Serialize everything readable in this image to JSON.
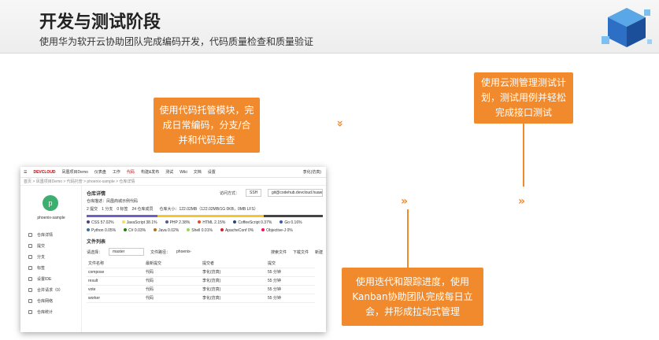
{
  "slide": {
    "title": "开发与测试阶段",
    "subtitle": "使用华为软开云协助团队完成编码开发，代码质量检查和质量验证"
  },
  "callouts": {
    "code": "使用代码托管模块，完成日常编码，分支/合并和代码走查",
    "test": "使用云测管理测试计划，测试用例并轻松完成接口测试",
    "kanban": "使用迭代和跟踪进度，使用Kanban协助团队完成每日立会，并形成拉动式管理"
  },
  "arrows": {
    "down": "»",
    "right": "»"
  },
  "colors": {
    "accent": "#f18a2c"
  },
  "shot": {
    "nav": {
      "logo": "DEVCLOUD",
      "project": "凤凰项目Demo",
      "items": [
        "仪表盘",
        "工作",
        "代码",
        "构建&发布",
        "测试",
        "Wiki",
        "文档",
        "设置"
      ],
      "active": "代码",
      "user": "李化(仿真)"
    },
    "crumb": {
      "path": "首页 > 凤凰项目Demo > 代码托管 > phoenix-sample > 仓库详情",
      "tabs": [
        "代码托管",
        "代码检查"
      ]
    },
    "repo": {
      "avatar": "p",
      "name": "phoenix-sample"
    },
    "menu": [
      "仓库详情",
      "提交",
      "分支",
      "标签",
      "设置IDE",
      "合并请求（0）",
      "仓库网络",
      "仓库统计"
    ],
    "detail": {
      "heading": "仓库详情",
      "desc": "仓库描述：凤凰商城示例代码",
      "clone_label": "访问方式：",
      "clone_proto": "SSH",
      "clone_url": "git@codehub.devcloud.huaw",
      "stats": "2 提交　1 分支　0 标签　24 仓库成员",
      "size": "仓库大小：122.02MB（122.02MB/1G 0KB，0MB LFS）"
    },
    "langs": [
      {
        "name": "CSS 57.02%",
        "color": "#563d7c"
      },
      {
        "name": "JavaScript 38.1%",
        "color": "#f1e05a"
      },
      {
        "name": "PHP 2.38%",
        "color": "#4f5d95"
      },
      {
        "name": "HTML 2.15%",
        "color": "#e34c26"
      },
      {
        "name": "CoffeeScript 0.37%",
        "color": "#244776"
      },
      {
        "name": "Go 0.16%",
        "color": "#375eab"
      },
      {
        "name": "Python 0.05%",
        "color": "#3572a5"
      },
      {
        "name": "C# 0.03%",
        "color": "#178600"
      },
      {
        "name": "Java 0.02%",
        "color": "#b07219"
      },
      {
        "name": "Shell 0.01%",
        "color": "#89e051"
      },
      {
        "name": "ApacheConf 0%",
        "color": "#d12127"
      },
      {
        "name": "Objective-J 0%",
        "color": "#ff0c5a"
      }
    ],
    "files": {
      "heading": "文件列表",
      "branch_label": "请选择：",
      "branch": "master",
      "path_label": "文件路径：",
      "path": "phoenix-",
      "actions": [
        "搜索文件",
        "下载文件",
        "新建"
      ],
      "columns": [
        "文件名称",
        "最新提交",
        "提交者",
        "提交"
      ],
      "rows": [
        [
          "compose",
          "代码  ",
          "李化(仿真)",
          "55 分钟"
        ],
        [
          "result",
          "代码  ",
          "李化(仿真)",
          "55 分钟"
        ],
        [
          "vote",
          "代码  ",
          "李化(仿真)",
          "55 分钟"
        ],
        [
          "worker",
          "代码  ",
          "李化(仿真)",
          "55 分钟"
        ]
      ]
    }
  }
}
